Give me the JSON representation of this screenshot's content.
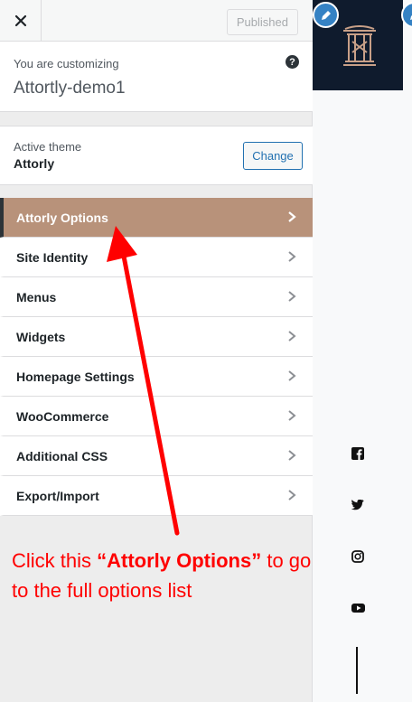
{
  "topbar": {
    "published_label": "Published"
  },
  "customizing": {
    "label": "You are customizing",
    "site_name": "Attortly-demo1",
    "help_glyph": "?"
  },
  "theme": {
    "label": "Active theme",
    "name": "Attorly",
    "change_label": "Change"
  },
  "menu": {
    "items": [
      {
        "label": "Attorly Options",
        "active": true
      },
      {
        "label": "Site Identity"
      },
      {
        "label": "Menus"
      },
      {
        "label": "Widgets"
      },
      {
        "label": "Homepage Settings"
      },
      {
        "label": "WooCommerce"
      },
      {
        "label": "Additional CSS"
      },
      {
        "label": "Export/Import"
      }
    ]
  },
  "annotation": {
    "prefix": "Click this ",
    "highlight": "“Attorly Options”",
    "suffix": " to go to the full options list"
  },
  "colors": {
    "active_item": "#b8927a",
    "annotation": "#ff0000",
    "header_dark": "#0f1b2d",
    "accent_blue": "#2271b1"
  },
  "icons": [
    "close-icon",
    "help-icon",
    "chevron-right-icon",
    "pencil-icon",
    "facebook-icon",
    "twitter-icon",
    "instagram-icon",
    "youtube-icon"
  ]
}
